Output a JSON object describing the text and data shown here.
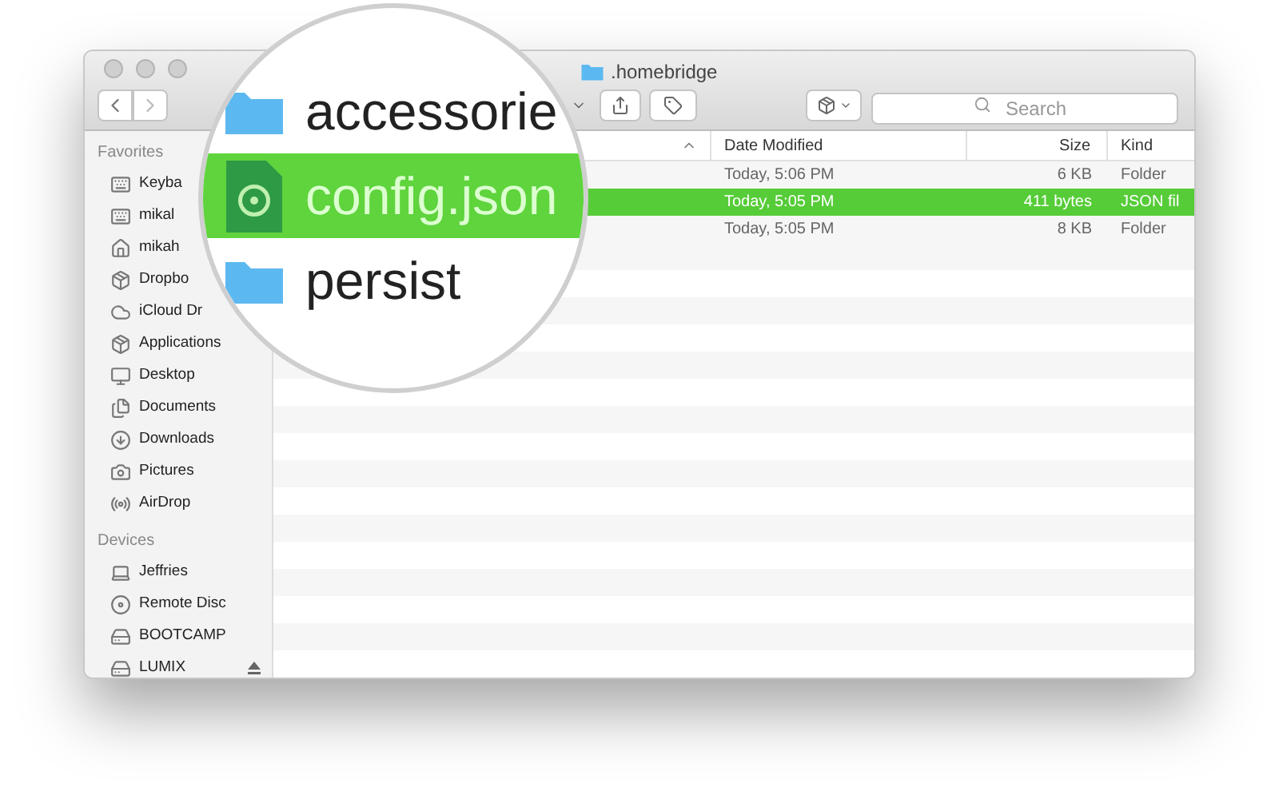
{
  "window": {
    "title": ".homebridge"
  },
  "toolbar": {
    "search": {
      "placeholder": "Search"
    }
  },
  "sidebar": {
    "sections": [
      {
        "header": "Favorites",
        "items": [
          {
            "label": "Keyba",
            "kind": "keyboard"
          },
          {
            "label": "mikal",
            "kind": "keyboard"
          },
          {
            "label": "mikah",
            "kind": "home"
          },
          {
            "label": "Dropbo",
            "kind": "dropbox"
          },
          {
            "label": "iCloud Dr",
            "kind": "cloud"
          },
          {
            "label": "Applications",
            "kind": "apps"
          },
          {
            "label": "Desktop",
            "kind": "desktop"
          },
          {
            "label": "Documents",
            "kind": "documents"
          },
          {
            "label": "Downloads",
            "kind": "downloads"
          },
          {
            "label": "Pictures",
            "kind": "camera"
          },
          {
            "label": "AirDrop",
            "kind": "airdrop"
          }
        ]
      },
      {
        "header": "Devices",
        "items": [
          {
            "label": "Jeffries",
            "kind": "laptop"
          },
          {
            "label": "Remote Disc",
            "kind": "disc"
          },
          {
            "label": "BOOTCAMP",
            "kind": "drive"
          },
          {
            "label": "LUMIX",
            "kind": "drive",
            "eject": true
          }
        ]
      }
    ]
  },
  "table": {
    "columns": [
      "Date Modified",
      "Size",
      "Kind"
    ],
    "rows": [
      {
        "date": "Today, 5:06 PM",
        "size": "6 KB",
        "kind": "Folder",
        "selected": false
      },
      {
        "date": "Today, 5:05 PM",
        "size": "411 bytes",
        "kind": "JSON fil",
        "selected": true
      },
      {
        "date": "Today, 5:05 PM",
        "size": "8 KB",
        "kind": "Folder",
        "selected": false
      }
    ]
  },
  "magnifier": {
    "rows": [
      {
        "name": "accessorie",
        "kind": "folder",
        "selected": false
      },
      {
        "name": "config.json",
        "kind": "json",
        "selected": true
      },
      {
        "name": "persist",
        "kind": "folder",
        "selected": false
      }
    ]
  }
}
